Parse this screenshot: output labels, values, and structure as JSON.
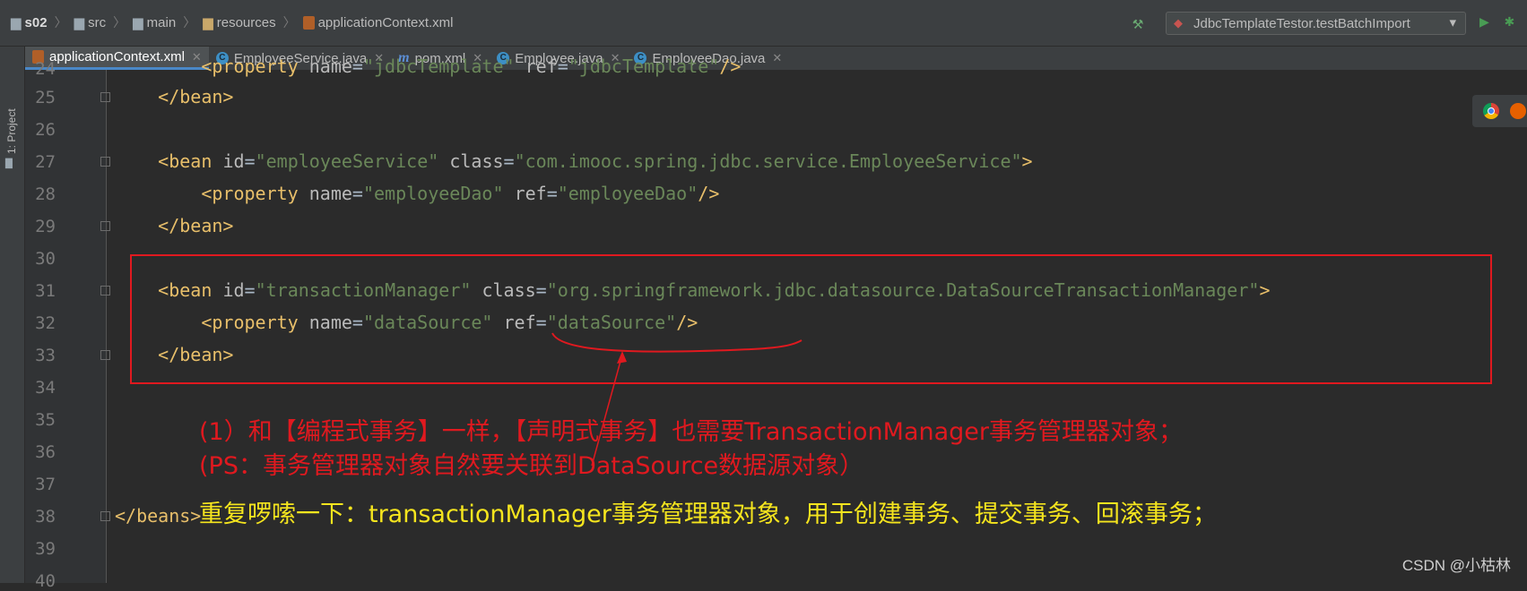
{
  "breadcrumb": [
    "s02",
    "src",
    "main",
    "resources",
    "applicationContext.xml"
  ],
  "run_config": "JdbcTemplateTestor.testBatchImport",
  "tabs": [
    {
      "label": "applicationContext.xml",
      "icon": "xml-icon",
      "active": true
    },
    {
      "label": "EmployeeService.java",
      "icon": "class-icon",
      "active": false
    },
    {
      "label": "pom.xml",
      "icon": "maven-icon",
      "active": false
    },
    {
      "label": "Employee.java",
      "icon": "class-icon",
      "active": false
    },
    {
      "label": "EmployeeDao.java",
      "icon": "class-icon",
      "active": false
    }
  ],
  "side_panel_label": "1: Project",
  "line_numbers": [
    "24",
    "25",
    "26",
    "27",
    "28",
    "29",
    "30",
    "31",
    "32",
    "33",
    "34",
    "35",
    "36",
    "37",
    "38",
    "39",
    "40"
  ],
  "code": {
    "l24": {
      "indent": "        ",
      "lt": "<",
      "tag": "property",
      "attr1": "name",
      "val1": "\"jdbcTemplate\"",
      "attr2": "ref",
      "val2": "\"jdbcTemplate\"",
      "end": "/>"
    },
    "l25": {
      "indent": "    ",
      "text": "</bean>"
    },
    "l27": {
      "indent": "    ",
      "lt": "<",
      "tag": "bean",
      "attr1": "id",
      "val1": "\"employeeService\"",
      "attr2": "class",
      "val2": "\"com.imooc.spring.jdbc.service.EmployeeService\"",
      "end": ">"
    },
    "l28": {
      "indent": "        ",
      "lt": "<",
      "tag": "property",
      "attr1": "name",
      "val1": "\"employeeDao\"",
      "attr2": "ref",
      "val2": "\"employeeDao\"",
      "end": "/>"
    },
    "l29": {
      "indent": "    ",
      "text": "</bean>"
    },
    "l31": {
      "indent": "    ",
      "lt": "<",
      "tag": "bean",
      "attr1": "id",
      "val1": "\"transactionManager\"",
      "attr2": "class",
      "val2": "\"org.springframework.jdbc.datasource.DataSourceTransactionManager\"",
      "end": ">"
    },
    "l32": {
      "indent": "        ",
      "lt": "<",
      "tag": "property",
      "attr1": "name",
      "val1": "\"dataSource\"",
      "attr2": "ref",
      "val2": "\"dataSource\"",
      "end": "/>"
    },
    "l33": {
      "indent": "    ",
      "text": "</bean>"
    },
    "l38": {
      "indent": "",
      "text": "</beans>"
    }
  },
  "annotations": {
    "red_line1": "(1）和【编程式事务】一样，【声明式事务】也需要TransactionManager事务管理器对象；",
    "red_line2": "(PS：事务管理器对象自然要关联到DataSource数据源对象）",
    "yellow_line": "重复啰嗦一下：transactionManager事务管理器对象，用于创建事务、提交事务、回滚事务；"
  },
  "watermark": "CSDN @小枯林",
  "colors": {
    "tag": "#e8bf6a",
    "attr": "#bababa",
    "value": "#6a8759",
    "annotation_red": "#e0191f",
    "annotation_yellow": "#f5e51e"
  }
}
